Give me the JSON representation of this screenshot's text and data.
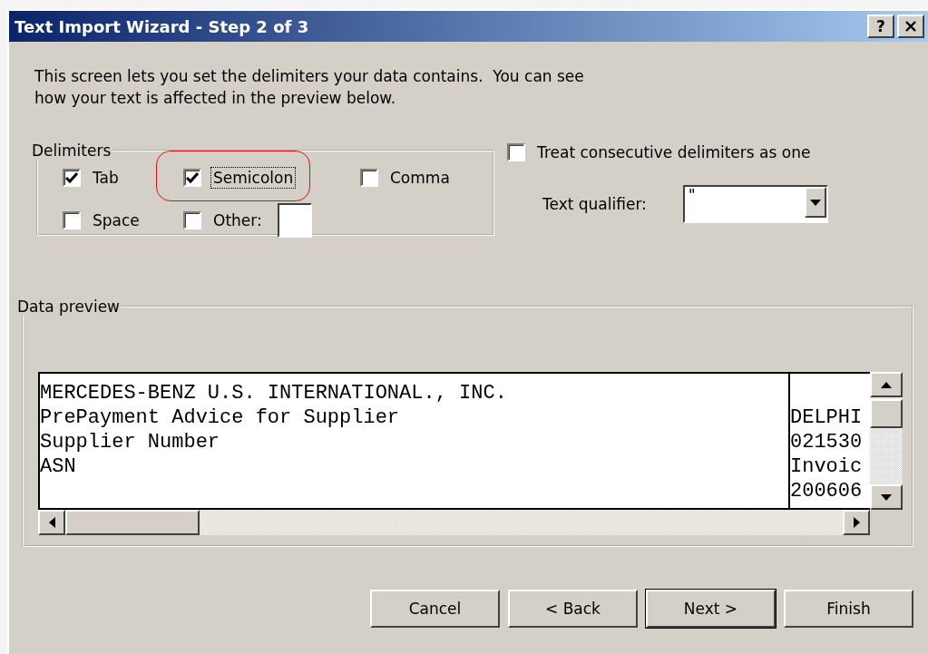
{
  "window": {
    "title": "Text Import Wizard - Step 2 of 3",
    "help_label": "?"
  },
  "intro": [
    "This screen lets you set the delimiters your data contains.  You can see",
    "how your text is affected in the preview below."
  ],
  "delimiters": {
    "title": "Delimiters",
    "items": [
      {
        "label": "Tab",
        "checked": true,
        "focused": false,
        "highlighted": false
      },
      {
        "label": "Semicolon",
        "checked": true,
        "focused": true,
        "highlighted": true
      },
      {
        "label": "Comma",
        "checked": false,
        "focused": false,
        "highlighted": false
      },
      {
        "label": "Space",
        "checked": false,
        "focused": false,
        "highlighted": false
      },
      {
        "label": "Other:",
        "checked": false,
        "focused": false,
        "highlighted": false,
        "kind": "with_field"
      }
    ]
  },
  "treat_consecutive": {
    "label": "Treat consecutive delimiters as one",
    "checked": false
  },
  "text_qualifier": {
    "label": "Text qualifier:",
    "value": "\""
  },
  "data_preview": {
    "title": "Data preview",
    "rows": [
      {
        "column_1": "MERCEDES-BENZ U.S. INTERNATIONAL., INC."
      },
      {
        "column_1": "PrePayment Advice for Supplier",
        "column_2": "DELPHI"
      },
      {
        "column_1": "Supplier Number",
        "column_2": "021530"
      },
      {
        "column_1": "ASN",
        "column_2": "Invoic"
      },
      {
        "column_2": "200606"
      }
    ]
  },
  "buttons": [
    {
      "label": "Cancel",
      "default": false
    },
    {
      "label": "< Back",
      "default": false
    },
    {
      "label": "Next >",
      "default": true
    },
    {
      "label": "Finish",
      "default": false
    }
  ]
}
